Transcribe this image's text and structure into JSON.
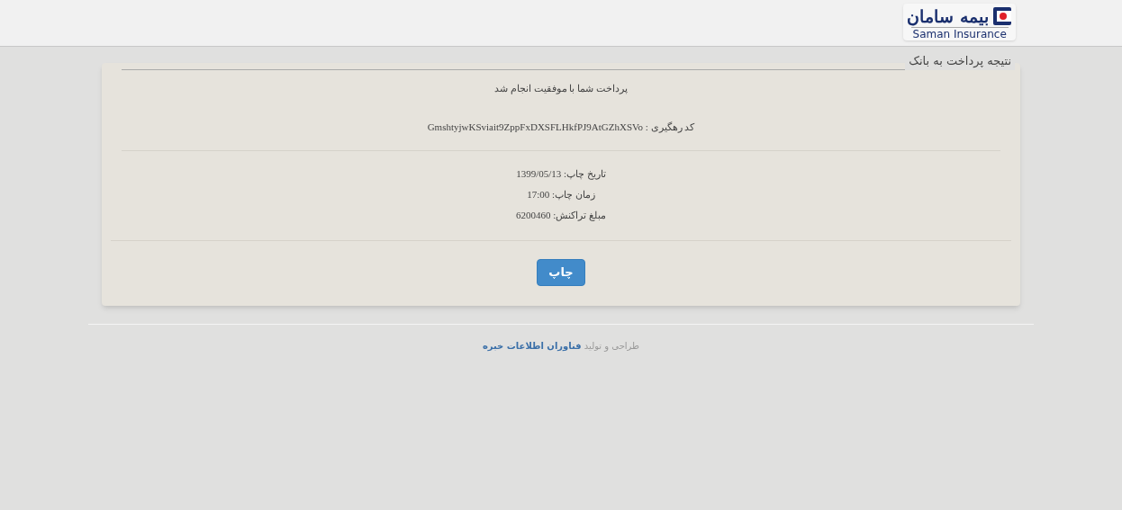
{
  "logo": {
    "name_fa": "بیمه سامان",
    "name_en": "Saman Insurance"
  },
  "page_title": "نتیجه پرداخت به بانک",
  "result": {
    "message": "پرداخت شما با موفقیت انجام شد",
    "tracking_code": "کد رهگیری : GmshtyjwKSviait9ZppFxDXSFLHkfPJ9AtGZhXSVo"
  },
  "details": [
    "تاریخ چاپ: 1399/05/13",
    "زمان چاپ: 17:00",
    "مبلغ تراکنش: 6200460"
  ],
  "print_button": "چاپ",
  "footer": {
    "text": "طراحی و تولید",
    "link": "فناوران اطلاعات خبره"
  }
}
